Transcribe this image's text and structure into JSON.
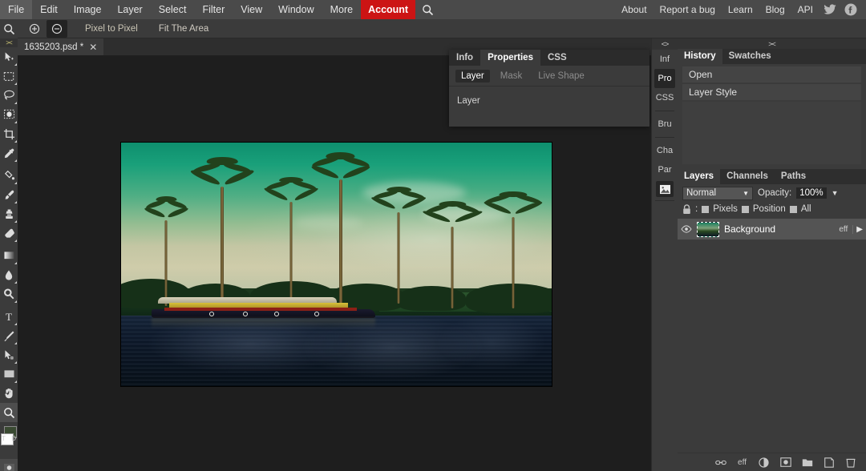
{
  "menubar": {
    "left_items": [
      {
        "label": "File",
        "name": "menu-file"
      },
      {
        "label": "Edit",
        "name": "menu-edit"
      },
      {
        "label": "Image",
        "name": "menu-image"
      },
      {
        "label": "Layer",
        "name": "menu-layer"
      },
      {
        "label": "Select",
        "name": "menu-select"
      },
      {
        "label": "Filter",
        "name": "menu-filter"
      },
      {
        "label": "View",
        "name": "menu-view"
      },
      {
        "label": "Window",
        "name": "menu-window"
      },
      {
        "label": "More",
        "name": "menu-more"
      },
      {
        "label": "Account",
        "name": "menu-account",
        "accent": true
      }
    ],
    "search_icon": "search-icon",
    "right_items": [
      {
        "label": "About",
        "name": "menu-about"
      },
      {
        "label": "Report a bug",
        "name": "menu-report-a-bug"
      },
      {
        "label": "Learn",
        "name": "menu-learn"
      },
      {
        "label": "Blog",
        "name": "menu-blog"
      },
      {
        "label": "API",
        "name": "menu-api"
      }
    ],
    "social": [
      {
        "icon": "twitter-icon"
      },
      {
        "icon": "facebook-icon"
      }
    ],
    "accent_color": "#cc1414"
  },
  "options_bar": {
    "tool_icon": "zoom-tool-icon",
    "zoom_in_label": "zoom-in-icon",
    "zoom_out_label": "zoom-out-icon",
    "pixel_to_pixel": "Pixel to Pixel",
    "fit_the_area": "Fit The Area"
  },
  "toolbar": {
    "collapse_glyph": "&gt;&lt;",
    "tools": [
      {
        "name": "zoom-search-tool",
        "icon": "magnifier-icon"
      },
      {
        "name": "move-tool",
        "icon": "move-arrow-icon"
      },
      {
        "name": "rectangular-marquee-tool",
        "icon": "marquee-icon"
      },
      {
        "name": "lasso-tool",
        "icon": "lasso-icon"
      },
      {
        "name": "magic-wand-tool",
        "icon": "magic-wand-icon"
      },
      {
        "name": "crop-tool",
        "icon": "crop-icon"
      },
      {
        "name": "eyedropper-tool",
        "icon": "eyedropper-icon"
      },
      {
        "name": "paint-bucket-tool",
        "icon": "paint-bucket-icon"
      },
      {
        "name": "brush-tool",
        "icon": "brush-icon"
      },
      {
        "name": "clone-stamp-tool",
        "icon": "clone-stamp-icon"
      },
      {
        "name": "eraser-tool",
        "icon": "eraser-icon"
      },
      {
        "name": "gradient-tool",
        "icon": "gradient-icon"
      },
      {
        "name": "blur-tool",
        "icon": "blur-drop-icon"
      },
      {
        "name": "dodge-tool",
        "icon": "dodge-icon"
      },
      {
        "name": "type-tool",
        "icon": "type-t-icon"
      },
      {
        "name": "pen-tool",
        "icon": "pen-icon"
      },
      {
        "name": "path-selection-tool",
        "icon": "path-select-icon"
      },
      {
        "name": "shape-tool",
        "icon": "rectangle-shape-icon"
      },
      {
        "name": "hand-tool",
        "icon": "hand-icon"
      },
      {
        "name": "zoom-tool",
        "icon": "magnifier-icon",
        "selected": true
      }
    ],
    "foreground_label": "T",
    "background_label": "D",
    "quick_mask_icon": "quick-mask-icon"
  },
  "document_tab": {
    "title": "1635203.psd *",
    "close_glyph": "✕"
  },
  "properties_panel": {
    "tabs": [
      {
        "label": "Info",
        "active": false
      },
      {
        "label": "Properties",
        "active": true
      },
      {
        "label": "CSS",
        "active": false
      }
    ],
    "subtabs": [
      {
        "label": "Layer",
        "active": true
      },
      {
        "label": "Mask",
        "active": false
      },
      {
        "label": "Live Shape",
        "active": false
      }
    ],
    "body_text": "Layer"
  },
  "vertical_strip": {
    "collapse_glyph": "&lt;&gt;",
    "tabs": [
      {
        "label": "Inf",
        "active": false
      },
      {
        "label": "Pro",
        "active": true
      },
      {
        "label": "CSS",
        "active": false
      },
      {
        "label": "Bru",
        "active": false
      },
      {
        "label": "Cha",
        "active": false
      },
      {
        "label": "Par",
        "active": false
      }
    ],
    "image_icon": "image-icon"
  },
  "dock": {
    "collapse_glyph": "&gt;&lt;",
    "history_panel": {
      "tabs": [
        {
          "label": "History",
          "active": true
        },
        {
          "label": "Swatches",
          "active": false
        }
      ],
      "items": [
        "Open",
        "Layer Style"
      ]
    },
    "layers_panel": {
      "tabs": [
        {
          "label": "Layers",
          "active": true
        },
        {
          "label": "Channels",
          "active": false
        },
        {
          "label": "Paths",
          "active": false
        }
      ],
      "blend_mode": "Normal",
      "blend_caret": "▼",
      "opacity_label": "Opacity:",
      "opacity_value": "100%",
      "opacity_caret": "▼",
      "lock_icon": "lock-icon",
      "lock_colon": ":",
      "lock_options": [
        "Pixels",
        "Position",
        "All"
      ],
      "layers": [
        {
          "name": "Background",
          "visible_icon": "eye-icon",
          "effects_label": "eff",
          "expand_glyph": "▶"
        }
      ],
      "footer_icons": [
        {
          "name": "link-layers-icon",
          "glyph": "⚭"
        },
        {
          "name": "layer-effects-icon",
          "glyph": "eff"
        },
        {
          "name": "adjustment-layer-icon",
          "glyph": "◑"
        },
        {
          "name": "layer-mask-icon",
          "glyph": "▣"
        },
        {
          "name": "new-group-icon",
          "glyph": "▰"
        },
        {
          "name": "new-layer-icon",
          "glyph": "❐"
        },
        {
          "name": "delete-layer-icon",
          "glyph": "Ὕ1"
        }
      ]
    }
  },
  "canvas": {
    "image_alt": "Tropical backwater scene with palm trees, houseboat and reflective water",
    "background_color": "#1e1e1e"
  }
}
